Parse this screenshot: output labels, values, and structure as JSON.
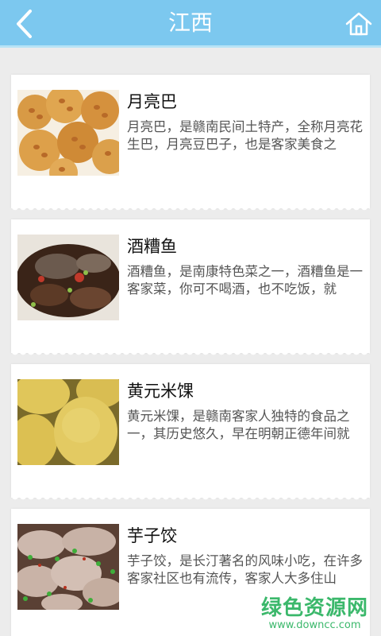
{
  "header": {
    "title": "江西",
    "back_icon": "chevron-left-icon",
    "home_icon": "home-icon",
    "color": "#7cc8ef"
  },
  "items": [
    {
      "name": "月亮巴",
      "desc": "月亮巴，是赣南民间土特产，全称月亮花生巴，月亮豆巴子，也是客家美食之",
      "image": "peanut-cracker-image"
    },
    {
      "name": "酒糟鱼",
      "desc": "酒糟鱼，是南康特色菜之一，酒糟鱼是一客家菜，你可不喝酒，也不吃饭，就",
      "image": "wine-fish-image"
    },
    {
      "name": "黄元米馃",
      "desc": "黄元米馃，是赣南客家人独特的食品之一，其历史悠久，早在明朝正德年间就",
      "image": "yellow-rice-cake-image"
    },
    {
      "name": "芋子饺",
      "desc": "芋子饺，是长汀著名的风味小吃，在许多客家社区也有流传，客家人大多住山",
      "image": "taro-dumpling-image"
    }
  ],
  "watermark": {
    "main": "绿色资源网",
    "sub": "www.downcc.com",
    "color": "#3bb86b"
  }
}
